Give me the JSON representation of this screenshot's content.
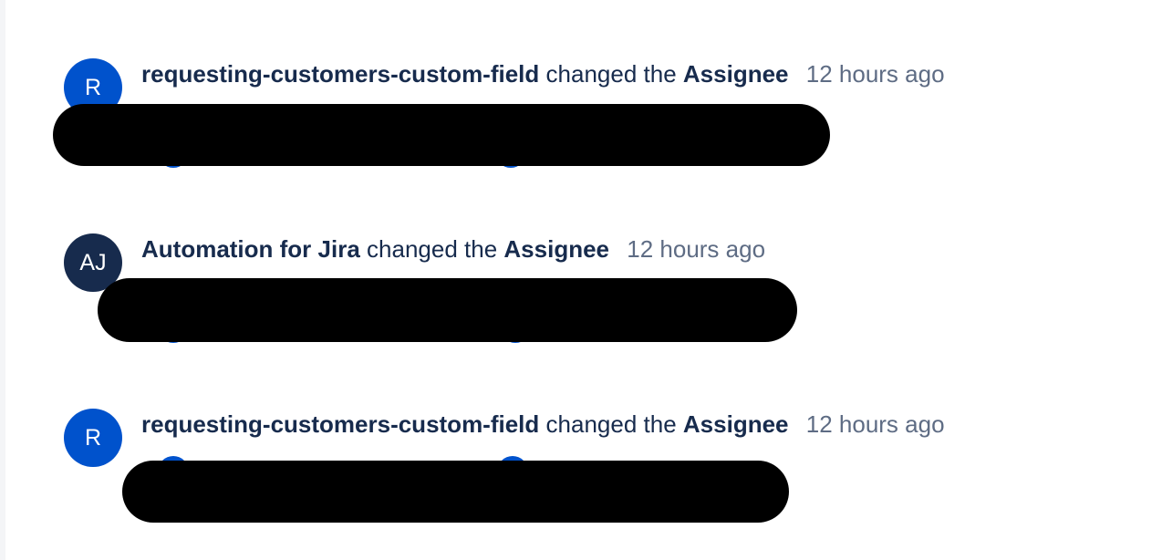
{
  "activity": [
    {
      "avatar_initials": "R",
      "avatar_color": "#0052cc",
      "actor": "requesting-customers-custom-field",
      "action": "changed the",
      "field": "Assignee",
      "timestamp": "12 hours ago"
    },
    {
      "avatar_initials": "AJ",
      "avatar_color": "#172b4d",
      "actor": "Automation for Jira",
      "action": "changed the",
      "field": "Assignee",
      "timestamp": "12 hours ago"
    },
    {
      "avatar_initials": "R",
      "avatar_color": "#0052cc",
      "actor": "requesting-customers-custom-field",
      "action": "changed the",
      "field": "Assignee",
      "timestamp": "12 hours ago"
    }
  ],
  "colors": {
    "text_primary": "#172b4d",
    "text_secondary": "#5e6c84",
    "redaction": "#000000"
  }
}
